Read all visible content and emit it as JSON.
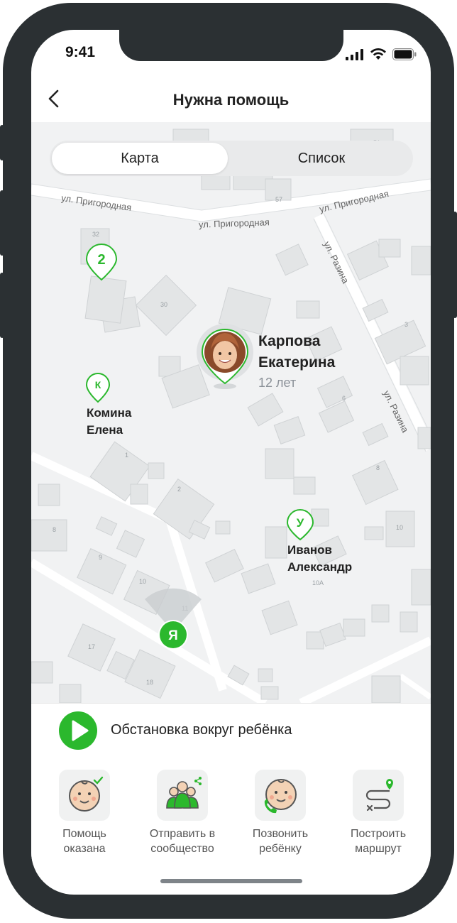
{
  "status_bar": {
    "time": "9:41"
  },
  "header": {
    "title": "Нужна помощь"
  },
  "tabs": [
    {
      "label": "Карта",
      "active": true
    },
    {
      "label": "Список",
      "active": false
    }
  ],
  "map": {
    "streets": [
      {
        "name": "ул. Пригородная"
      },
      {
        "name": "ул. Пригородная"
      },
      {
        "name": "ул. Пригородная"
      },
      {
        "name": "ул. Разина"
      },
      {
        "name": "ул. Разина"
      }
    ],
    "markers": [
      {
        "letter": "2",
        "type": "cluster"
      },
      {
        "letter": "К",
        "line1": "Комина",
        "line2": "Елена"
      },
      {
        "letter": "У",
        "line1": "Иванов",
        "line2": "Александр"
      },
      {
        "letter": "Я",
        "type": "me"
      }
    ],
    "child": {
      "line1": "Карпова",
      "line2": "Екатерина",
      "age": "12 лет"
    }
  },
  "audio": {
    "label": "Обстановка вокруг ребёнка"
  },
  "actions": [
    {
      "line1": "Помощь",
      "line2": "оказана",
      "icon": "baby-check-icon"
    },
    {
      "line1": "Отправить в",
      "line2": "сообщество",
      "icon": "community-share-icon"
    },
    {
      "line1": "Позвонить",
      "line2": "ребёнку",
      "icon": "baby-phone-icon"
    },
    {
      "line1": "Построить",
      "line2": "маршрут",
      "icon": "route-icon"
    }
  ],
  "colors": {
    "accent": "#2bb82d",
    "frame": "#2b3033",
    "map_bg": "#f1f2f3"
  }
}
